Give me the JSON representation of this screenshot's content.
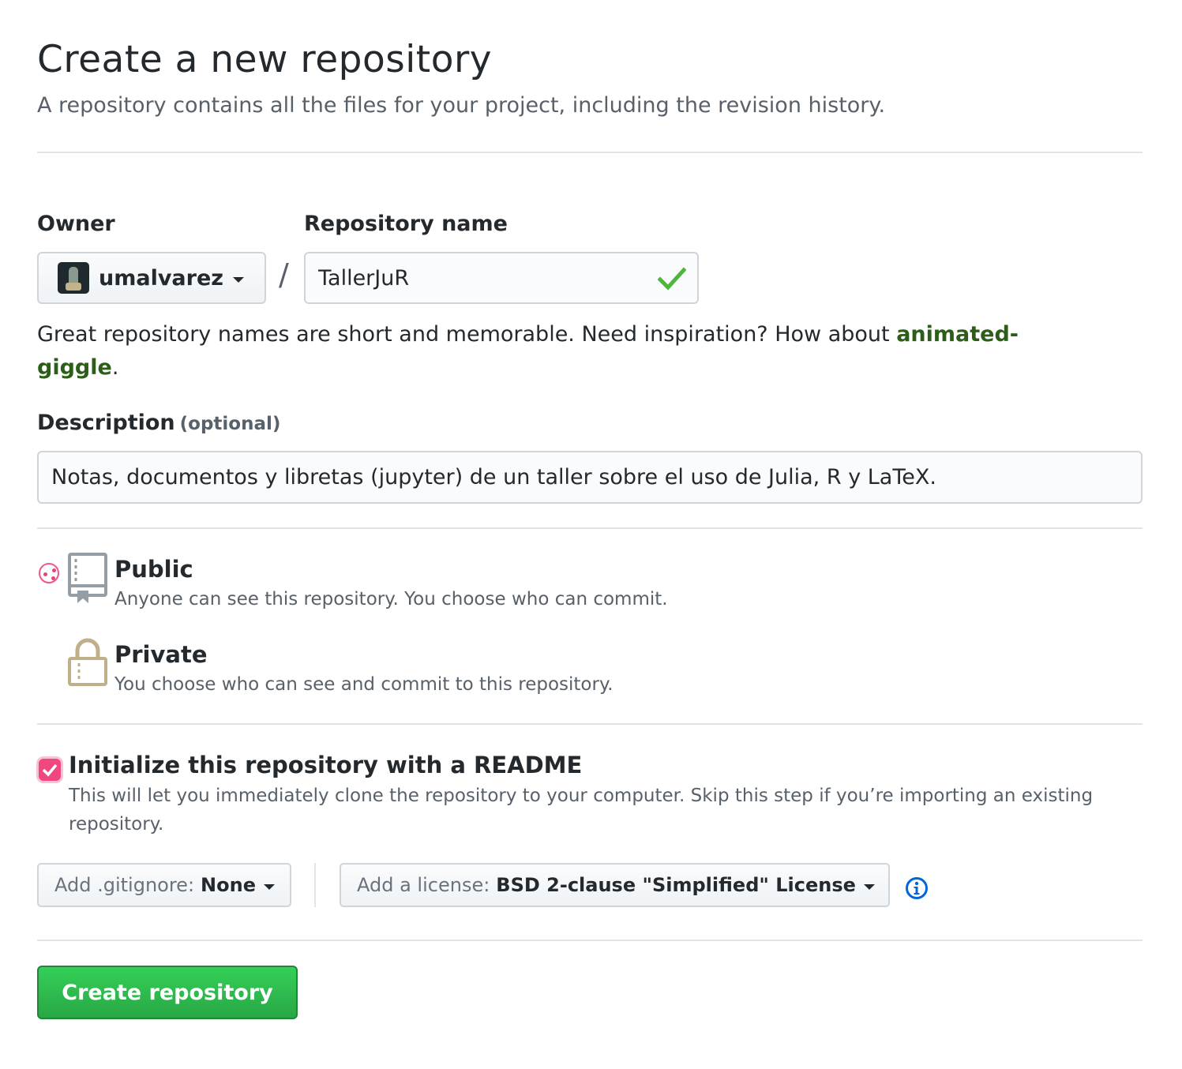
{
  "header": {
    "title": "Create a new repository",
    "subtitle": "A repository contains all the files for your project, including the revision history."
  },
  "owner": {
    "label": "Owner",
    "value": "umalvarez"
  },
  "separator": "/",
  "repo": {
    "label": "Repository name",
    "value": "TallerJuR",
    "valid_color": "#4eb63a"
  },
  "hint": {
    "text": "Great repository names are short and memorable. Need inspiration? How about ",
    "suggestion": "animated-giggle",
    "suffix": "."
  },
  "description": {
    "label": "Description",
    "optional": "(optional)",
    "value": "Notas, documentos y libretas (jupyter) de un taller sobre el uso de Julia, R y LaTeX."
  },
  "visibility": {
    "selected": "public",
    "public": {
      "title": "Public",
      "desc": "Anyone can see this repository. You choose who can commit.",
      "icon": "repo-icon"
    },
    "private": {
      "title": "Private",
      "desc": "You choose who can see and commit to this repository.",
      "icon": "lock-icon"
    }
  },
  "readme": {
    "checked": true,
    "title": "Initialize this repository with a README",
    "desc": "This will let you immediately clone the repository to your computer. Skip this step if you’re importing an existing repository."
  },
  "gitignore": {
    "prefix": "Add .gitignore:",
    "value": "None"
  },
  "license": {
    "prefix": "Add a license:",
    "value": "BSD 2-clause \"Simplified\" License"
  },
  "submit": {
    "label": "Create repository"
  },
  "colors": {
    "accent_pink": "#f0477e",
    "primary_green": "#28a745",
    "link_blue": "#0366d6",
    "suggestion_green": "#2c5e1a"
  }
}
